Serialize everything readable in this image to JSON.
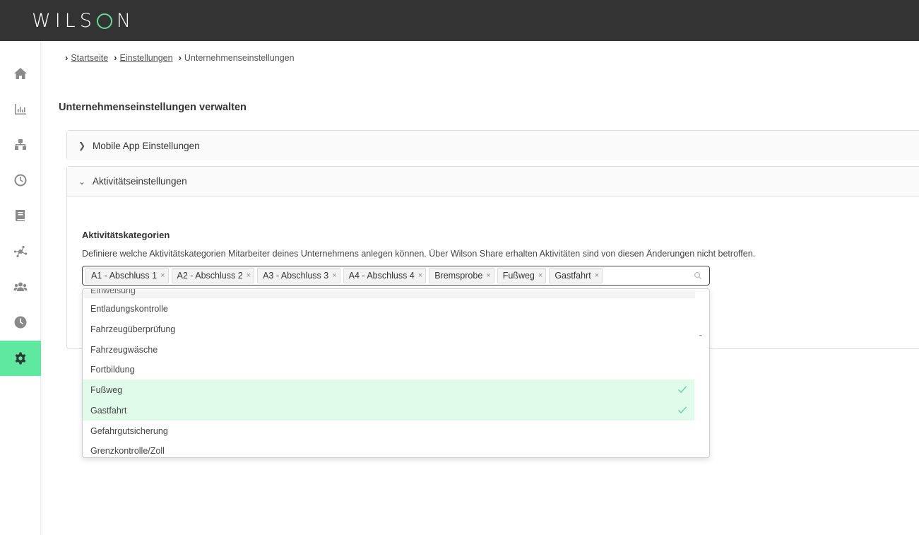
{
  "app": {
    "logo_text": "WILSON"
  },
  "sidebar": {
    "items": [
      {
        "icon": "home-icon"
      },
      {
        "icon": "bar-chart-icon"
      },
      {
        "icon": "network-icon"
      },
      {
        "icon": "clock-icon"
      },
      {
        "icon": "book-icon"
      },
      {
        "icon": "graph-nodes-icon"
      },
      {
        "icon": "users-icon"
      },
      {
        "icon": "history-icon"
      },
      {
        "icon": "gear-icon",
        "active": true
      }
    ],
    "active_color": "#5fe8a0"
  },
  "breadcrumb": {
    "items": [
      "Startseite",
      "Einstellungen"
    ],
    "current": "Unternehmenseinstellungen"
  },
  "page": {
    "title": "Unternehmenseinstellungen verwalten"
  },
  "panels": {
    "mobile": {
      "label": "Mobile App Einstellungen",
      "expanded": false
    },
    "activity": {
      "label": "Aktivitätseinstellungen",
      "expanded": true,
      "section_title": "Aktivitätskategorien",
      "section_desc": "Definiere welche Aktivitätskategorien Mitarbeiter deines Unternehmens anlegen können. Über Wilson Share erhalten Aktivitäten sind von diesen Änderungen nicht betroffen."
    }
  },
  "select": {
    "tags": [
      "A1 - Abschluss 1",
      "A2 - Abschluss 2",
      "A3 - Abschluss 3",
      "A4 - Abschluss 4",
      "Bremsprobe",
      "Fußweg",
      "Gastfahrt"
    ],
    "remove_glyph": "×"
  },
  "dropdown": {
    "partial_top": "Einweisung",
    "options": [
      {
        "label": "Entladungskontrolle",
        "selected": false
      },
      {
        "label": "Fahrzeugüberprüfung",
        "selected": false
      },
      {
        "label": "Fahrzeugwäsche",
        "selected": false
      },
      {
        "label": "Fortbildung",
        "selected": false
      },
      {
        "label": "Fußweg",
        "selected": true
      },
      {
        "label": "Gastfahrt",
        "selected": true
      },
      {
        "label": "Gefahrgutsicherung",
        "selected": false
      },
      {
        "label": "Grenzkontrolle/Zoll",
        "selected": false
      }
    ],
    "selected_color": "#e0fbea",
    "check_color": "#5fd39a"
  }
}
